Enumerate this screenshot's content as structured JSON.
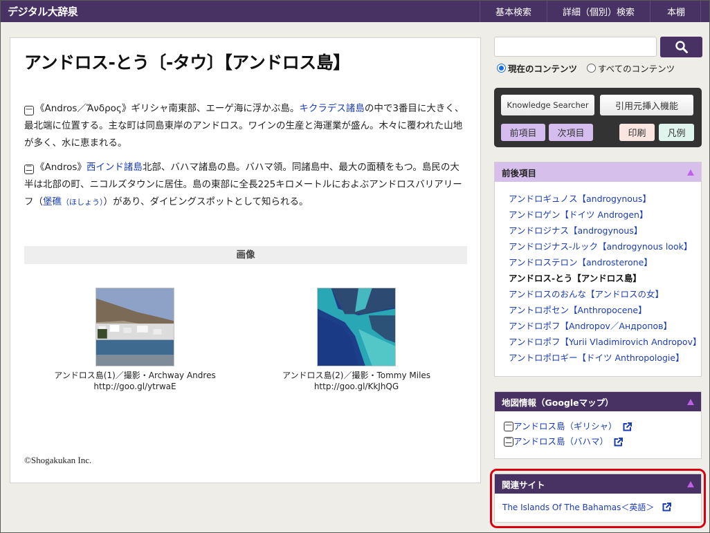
{
  "header": {
    "logo": "デジタル大辞泉",
    "nav": [
      "基本検索",
      "詳細（個別）検索",
      "本棚"
    ]
  },
  "article": {
    "title": "アンドロス-とう〔-タウ〕【アンドロス島】",
    "para1": {
      "marker": "一",
      "before": "《Andros／Ἄνδρος》ギリシャ南東部、エーゲ海に浮かぶ島。",
      "link": "キクラデス諸島",
      "after": "の中で3番目に大きく、最北端に位置する。主な町は同島東岸のアンドロス。ワインの生産と海運業が盛ん。木々に覆われた山地が多く、水に恵まれる。"
    },
    "para2": {
      "marker": "二",
      "before": "《Andros》",
      "link": "西インド諸島",
      "middle": "北部、バハマ諸島の島。バハマ領。同諸島中、最大の面積をもつ。島民の大半は北部の町、ニコルズタウンに居住。島の東部に全長225キロメートルにおよぶアンドロスバリアリーフ（",
      "link2": "堡礁",
      "link2_ruby": "（ほしょう）",
      "after": "）があり、ダイビングスポットとして知られる。"
    },
    "images_heading": "画像",
    "images": [
      {
        "caption": "アンドロス島(1)／撮影・Archway Andres",
        "url": "http://goo.gl/ytrwaE"
      },
      {
        "caption": "アンドロス島(2)／撮影・Tommy Miles",
        "url": "http://goo.gl/KkJhQG"
      }
    ],
    "copyright": "©Shogakukan Inc."
  },
  "search": {
    "input_value": "",
    "placeholder": "",
    "scope_options": [
      "現在のコンテンツ",
      "すべてのコンテンツ"
    ],
    "scope_selected": "現在のコンテンツ"
  },
  "toolbox": {
    "knowledge_searcher": "Knowledge Searcher",
    "cite": "引用元挿入機能",
    "prev": "前項目",
    "next": "次項目",
    "print": "印刷",
    "legend": "凡例"
  },
  "adjacent": {
    "title": "前後項目",
    "items": [
      {
        "label": "アンドロギュノス【androgynous】",
        "current": false
      },
      {
        "label": "アンドロゲン【ドイツ Androgen】",
        "current": false
      },
      {
        "label": "アンドロジナス【androgynous】",
        "current": false
      },
      {
        "label": "アンドロジナス-ルック【androgynous look】",
        "current": false
      },
      {
        "label": "アンドロステロン【androsterone】",
        "current": false
      },
      {
        "label": "アンドロス-とう【アンドロス島】",
        "current": true
      },
      {
        "label": "アンドロスのおんな【アンドロスの女】",
        "current": false
      },
      {
        "label": "アントロポセン【Anthropocene】",
        "current": false
      },
      {
        "label": "アンドロポフ【Andropov／Андропов】",
        "current": false
      },
      {
        "label": "アンドロポフ【Yurii Vladimirovich Andropov】",
        "current": false
      },
      {
        "label": "アントロポロギー【ドイツ Anthropologie】",
        "current": false
      }
    ]
  },
  "map": {
    "title": "地図情報（Googleマップ）",
    "items": [
      {
        "marker": "一",
        "label": "アンドロス島（ギリシャ）"
      },
      {
        "marker": "二",
        "label": "アンドロス島（バハマ）"
      }
    ]
  },
  "related": {
    "title": "関連サイト",
    "items": [
      {
        "label": "The Islands Of The Bahamas＜英語＞"
      }
    ]
  },
  "colors": {
    "brand": "#483264",
    "link": "#1a3db5",
    "adjacent_header": "#d7bfec",
    "highlight_frame": "#d6000f"
  }
}
